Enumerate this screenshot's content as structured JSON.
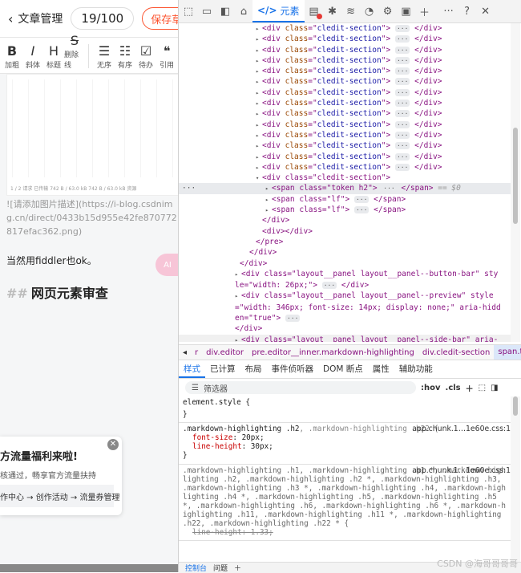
{
  "editor": {
    "back_label": "文章管理",
    "word_count": "19/100",
    "save_label": "保存草稿",
    "toolbar": [
      {
        "glyph": "B",
        "label": "加粗",
        "icon": "bold-icon"
      },
      {
        "glyph": "I",
        "label": "斜体",
        "icon": "italic-icon"
      },
      {
        "glyph": "H",
        "label": "标题",
        "icon": "heading-icon"
      },
      {
        "glyph": "S",
        "label": "删除线",
        "icon": "strikethrough-icon"
      },
      {
        "glyph": "☰",
        "label": "无序",
        "icon": "unordered-list-icon"
      },
      {
        "glyph": "☷",
        "label": "有序",
        "icon": "ordered-list-icon"
      },
      {
        "glyph": "☑",
        "label": "待办",
        "icon": "todo-list-icon"
      },
      {
        "glyph": "❝",
        "label": "引用",
        "icon": "quote-icon"
      }
    ],
    "image_footer": "1 / 2 请求   已传输 742 B / 63.0 kB   742 B / 63.0 kB 资源",
    "markdown_image": "![请添加图片描述](https://i-blog.csdnimg.cn/direct/0433b15d955e42fe870772817efac362.png)",
    "paragraph": "当然用fiddler也ok。",
    "heading_hash": "##",
    "heading_text": "网页元素审查",
    "ai_label": "AI",
    "promo": {
      "title": "方流量福利来啦!",
      "subtitle": "核通过，畅享官方流量扶持",
      "link": "作中心 → 创作活动 → 流量券管理",
      "close": "✕"
    }
  },
  "devtools": {
    "active_tab": "元素",
    "tab_glyph": "</>",
    "more": "···",
    "help": "?",
    "close": "✕",
    "breadcrumbs": [
      "r",
      "div.editor",
      "pre.editor__inner.markdown-highlighting",
      "div.cledit-section",
      "span.token.h2"
    ],
    "panel_tabs": [
      "样式",
      "已计算",
      "布局",
      "事件侦听器",
      "DOM 断点",
      "属性",
      "辅助功能"
    ],
    "filter_placeholder": "筛选器",
    "filter_hov": ":hov",
    "filter_cls": ".cls",
    "drawer_tabs": [
      "控制台",
      "问题"
    ],
    "watermark": "CSDN @海哥哥哥哥"
  },
  "dom": {
    "section_tag": "div",
    "section_attr": "class",
    "section_class": "cledit-section",
    "collapsed_count": 14,
    "open_section": "<div class=\"cledit-section\">",
    "span1": {
      "open": "<span class=\"token h2\">",
      "close": "</span>",
      "marker": "== $0"
    },
    "span2": {
      "open": "<span class=\"lf\">",
      "close": "</span>"
    },
    "span3": {
      "open": "<span class=\"lf\">",
      "close": "</span>"
    },
    "close_div": "</div>",
    "close_div_div": "<div></div>",
    "close_pre": "</pre>",
    "layout1": {
      "open": "<div class=\"layout__panel layout__panel--button-bar\" style=\"width: 26px;\">",
      "close": "</div>"
    },
    "layout2": {
      "open": "<div class=\"layout__panel layout__panel--preview\" style=\"width: 346px; font-size: 14px; display: none;\" aria-hidden=\"true\">",
      "close": "</div>"
    },
    "layout3": {
      "open": "<div class=\"layout__panel layout__panel--side-bar\" aria-hidden=\"true\" style=\"height: 803px; display: none;\">",
      "close": "</div>"
    },
    "ellipsis": "···",
    "gutter": "···"
  },
  "styles": {
    "element_style": "element.style {",
    "brace_close": "}",
    "rule1": {
      "selector": ".markdown-highlighting .h2",
      "muted": ", .markdown-highlighting .h22 {",
      "source": "app.chunk.1…1e60e.css:1",
      "props": [
        {
          "name": "font-size",
          "value": "20px;"
        },
        {
          "name": "line-height",
          "value": "30px;"
        }
      ]
    },
    "rule2": {
      "source": "app.chunk.1…1e60e.css:1",
      "selector_text": ".markdown-highlighting .h1, .markdown-highlighting .h1 *, .markdown-highlighting .h2, .markdown-highlighting .h2 *, .markdown-highlighting .h3, .markdown-highlighting .h3 *, .markdown-highlighting .h4, .markdown-highlighting .h4 *, .markdown-highlighting .h5, .markdown-highlighting .h5 *, .markdown-highlighting .h6, .markdown-highlighting .h6 *, .markdown-highlighting .h11, .markdown-highlighting .h11 *, .markdown-highlighting .h22, .markdown-highlighting .h22 * {",
      "strike_prop": "line-height: 1.33;"
    }
  }
}
